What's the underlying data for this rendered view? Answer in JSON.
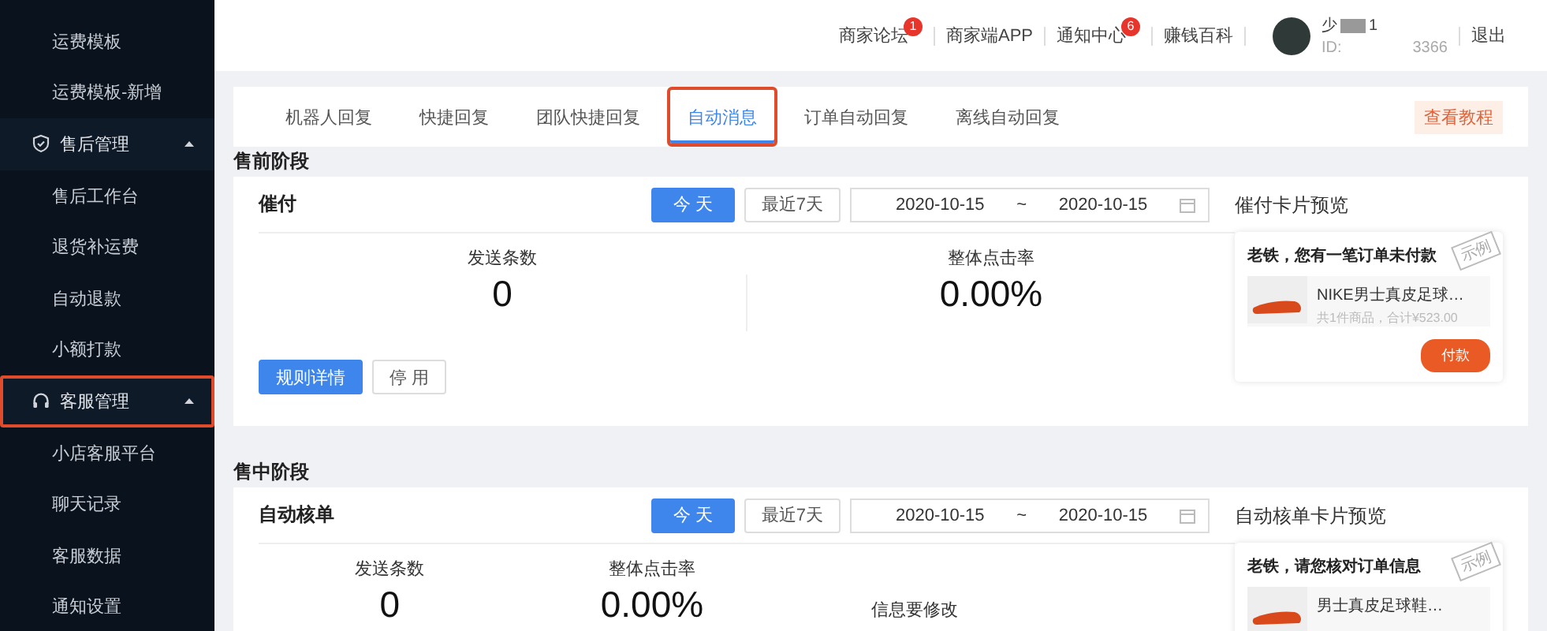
{
  "sidebar": {
    "items": [
      {
        "kind": "link",
        "label": "运费模板"
      },
      {
        "kind": "link",
        "label": "运费模板-新增"
      },
      {
        "kind": "group",
        "label": "售后管理",
        "expanded": true,
        "highlighted": false,
        "children": [
          {
            "label": "售后工作台"
          },
          {
            "label": "退货补运费"
          },
          {
            "label": "自动退款"
          },
          {
            "label": "小额打款"
          }
        ]
      },
      {
        "kind": "group",
        "label": "客服管理",
        "expanded": true,
        "highlighted": true,
        "children": [
          {
            "label": "小店客服平台"
          },
          {
            "label": "聊天记录"
          },
          {
            "label": "客服数据"
          },
          {
            "label": "通知设置"
          }
        ]
      }
    ]
  },
  "top_bar": {
    "links": [
      {
        "label": "商家论坛",
        "badge": "1"
      },
      {
        "label": "商家端APP"
      },
      {
        "label": "通知中心",
        "badge": "6"
      },
      {
        "label": "赚钱百科"
      }
    ],
    "user": {
      "name_start": "少",
      "name_end": "1",
      "id_label": "ID:",
      "id_end": "3366"
    },
    "logout": "退出"
  },
  "tabs": [
    {
      "label": "机器人回复",
      "selected": false,
      "highlighted": false
    },
    {
      "label": "快捷回复",
      "selected": false,
      "highlighted": false
    },
    {
      "label": "团队快捷回复",
      "selected": false,
      "highlighted": false
    },
    {
      "label": "自动消息",
      "selected": true,
      "highlighted": true
    },
    {
      "label": "订单自动回复",
      "selected": false,
      "highlighted": false
    },
    {
      "label": "离线自动回复",
      "selected": false,
      "highlighted": false
    }
  ],
  "tutorial_button": "查看教程",
  "sections": [
    {
      "title": "售前阶段",
      "card": {
        "title": "催付",
        "range_buttons": [
          {
            "label": "今 天",
            "selected": true
          },
          {
            "label": "最近7天",
            "selected": false
          }
        ],
        "date_start": "2020-10-15",
        "date_sep": "~",
        "date_end": "2020-10-15",
        "stats": [
          {
            "label": "发送条数",
            "value": "0"
          },
          {
            "label": "整体点击率",
            "value": "0.00%"
          }
        ],
        "actions": [
          {
            "label": "规则详情",
            "kind": "primary"
          },
          {
            "label": "停 用",
            "kind": "default"
          }
        ],
        "preview": {
          "title": "催付卡片预览",
          "message": "老铁，您有一笔订单未付款",
          "product_name": "NIKE男士真皮足球…",
          "product_meta": "共1件商品，合计¥523.00",
          "button": "付款",
          "stamp": "示例"
        }
      }
    },
    {
      "title": "售中阶段",
      "card": {
        "title": "自动核单",
        "range_buttons": [
          {
            "label": "今 天",
            "selected": true
          },
          {
            "label": "最近7天",
            "selected": false
          }
        ],
        "date_start": "2020-10-15",
        "date_sep": "~",
        "date_end": "2020-10-15",
        "stats": [
          {
            "label": "发送条数",
            "value": "0"
          },
          {
            "label": "整体点击率",
            "value": "0.00%"
          },
          {
            "label": "信息要修改"
          }
        ],
        "preview": {
          "title": "自动核单卡片预览",
          "message": "老铁，请您核对订单信息",
          "product_name": "男士真皮足球鞋…",
          "stamp": "示例"
        }
      }
    }
  ]
}
